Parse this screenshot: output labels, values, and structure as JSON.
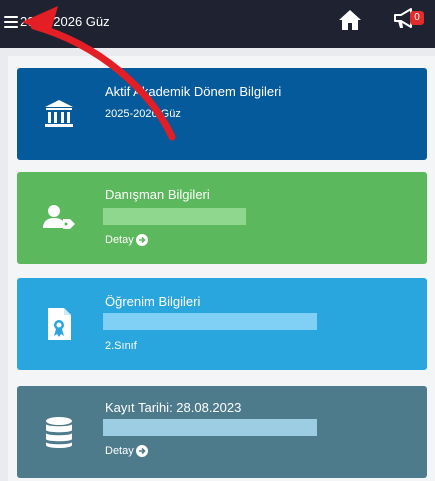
{
  "header": {
    "term_label": "2025-2026 Güz",
    "announcement_count": "0"
  },
  "cards": {
    "term": {
      "title": "Aktif Akademik Dönem Bilgileri",
      "subtitle": "2025-2026 Güz",
      "color": "#055a9b"
    },
    "advisor": {
      "title": "Danışman Bilgileri",
      "detail_label": "Detay",
      "color": "#5cb85c",
      "bar_color": "#8fd68f"
    },
    "education": {
      "title": "Öğrenim Bilgileri",
      "class_label": "2.Sınıf",
      "color": "#2aa6df",
      "bar_color": "#7fd0f4"
    },
    "registration": {
      "title": "Kayıt Tarihi: 28.08.2023",
      "detail_label": "Detay",
      "color": "#4e7b8c",
      "bar_color": "#9ccde3"
    }
  },
  "colors": {
    "topbar": "#1f2331",
    "badge": "#e32b2b",
    "annotation_arrow": "#e31e24"
  }
}
